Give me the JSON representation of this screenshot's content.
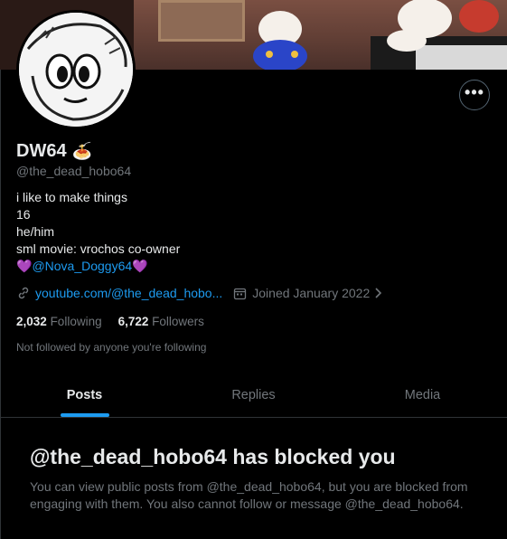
{
  "profile": {
    "display_name": "DW64",
    "name_emoji": "🍝",
    "handle": "@the_dead_hobo64",
    "bio_lines": [
      "i like to make things",
      "16",
      "he/him",
      "sml movie: vrochos co-owner"
    ],
    "bio_mention": "@Nova_Doggy64",
    "bio_heart": "💜",
    "website": "youtube.com/@the_dead_hobo...",
    "joined": "Joined January 2022",
    "following_count": "2,032",
    "following_label": "Following",
    "followers_count": "6,722",
    "followers_label": "Followers",
    "not_followed": "Not followed by anyone you're following"
  },
  "more_button_label": "•••",
  "tabs": [
    {
      "label": "Posts",
      "active": true
    },
    {
      "label": "Replies",
      "active": false
    },
    {
      "label": "Media",
      "active": false
    }
  ],
  "blocked": {
    "title": "@the_dead_hobo64 has blocked you",
    "body": "You can view public posts from @the_dead_hobo64, but you are blocked from engaging with them. You also cannot follow or message @the_dead_hobo64."
  },
  "icons": [
    "link-icon",
    "calendar-icon",
    "chevron-right-icon",
    "more-icon"
  ],
  "colors": {
    "accent": "#1d9bf0",
    "muted": "#71767b",
    "text": "#e7e9ea",
    "background": "#000000"
  }
}
